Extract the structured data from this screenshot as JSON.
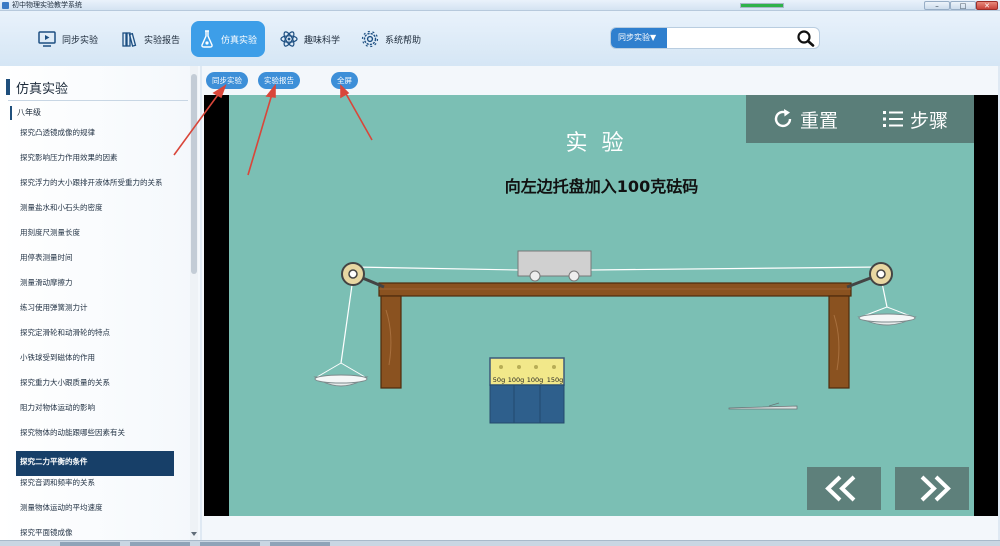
{
  "window": {
    "title": "初中物理实验教学系统"
  },
  "taskbar_progress": {
    "fraction": 1.0,
    "color": "#2fb24a"
  },
  "nav": {
    "items": [
      {
        "label": "同步实验",
        "icon": "monitor-play-icon",
        "active": false
      },
      {
        "label": "实验报告",
        "icon": "books-icon",
        "active": false
      },
      {
        "label": "仿真实验",
        "icon": "flask-icon",
        "active": true
      },
      {
        "label": "趣味科学",
        "icon": "atom-icon",
        "active": false
      },
      {
        "label": "系统帮助",
        "icon": "gear-icon",
        "active": false
      }
    ],
    "active_color": "#3d9ee8"
  },
  "search": {
    "category": "同步实验▼",
    "placeholder": "",
    "value": ""
  },
  "sidebar": {
    "title": "仿真实验",
    "grade": "八年级",
    "items": [
      "探究凸透镜成像的规律",
      "探究影响压力作用效果的因素",
      "探究浮力的大小跟排开液体所受重力的关系",
      "测量盐水和小石头的密度",
      "用刻度尺测量长度",
      "用停表测量时间",
      "测量滑动摩擦力",
      "练习使用弹簧测力计",
      "探究定滑轮和动滑轮的特点",
      "小铁球受到磁体的作用",
      "探究重力大小跟质量的关系",
      "阻力对物体运动的影响",
      "探究物体的动能跟哪些因素有关",
      "探究二力平衡的条件",
      "探究音调和频率的关系",
      "测量物体运动的平均速度",
      "探究平面镜成像"
    ],
    "active_index": 13,
    "active_color": "#173f68"
  },
  "content": {
    "buttons": {
      "sync": "同步实验",
      "report": "实验报告",
      "fullscreen": "全屏"
    }
  },
  "simulation": {
    "heading": "实验",
    "instruction": "向左边托盘加入100克砝码",
    "reset_label": "重置",
    "steps_label": "步骤",
    "weight_labels": [
      "50g",
      "100g",
      "100g",
      "150g"
    ],
    "prev_icon": "double-chevron-left-icon",
    "next_icon": "double-chevron-right-icon",
    "stage_color": "#7bbfb4",
    "toolbar_color": "#5a7e79"
  }
}
